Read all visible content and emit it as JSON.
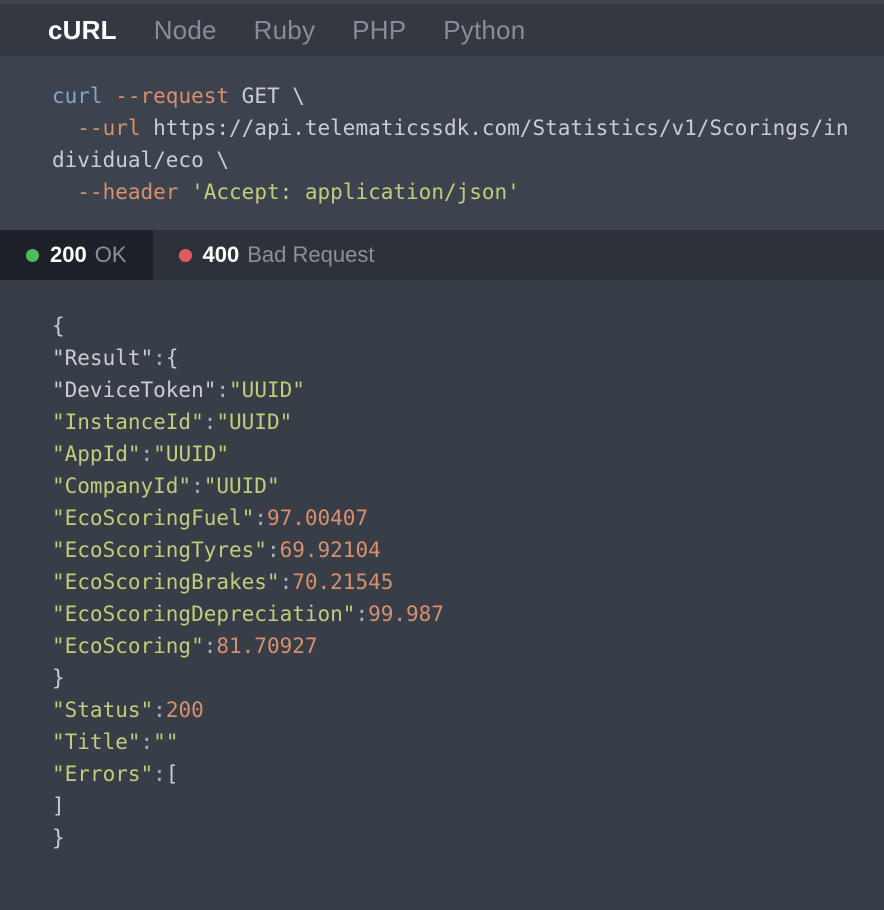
{
  "language_tabs": {
    "items": [
      {
        "label": "cURL",
        "active": true
      },
      {
        "label": "Node",
        "active": false
      },
      {
        "label": "Ruby",
        "active": false
      },
      {
        "label": "PHP",
        "active": false
      },
      {
        "label": "Python",
        "active": false
      }
    ]
  },
  "request": {
    "language": "cURL",
    "lines": [
      [
        {
          "text": "curl",
          "type": "fn"
        },
        {
          "text": " ",
          "type": "plain"
        },
        {
          "text": "--request",
          "type": "flag"
        },
        {
          "text": " GET \\",
          "type": "plain"
        }
      ],
      [
        {
          "text": "  ",
          "type": "plain"
        },
        {
          "text": "--url",
          "type": "flag"
        },
        {
          "text": " https://api.telematicssdk.com/Statistics/v1/Scorings/individual/eco \\",
          "type": "plain"
        }
      ],
      [
        {
          "text": "  ",
          "type": "plain"
        },
        {
          "text": "--header",
          "type": "flag"
        },
        {
          "text": " ",
          "type": "plain"
        },
        {
          "text": "'Accept: application/json'",
          "type": "string"
        }
      ]
    ],
    "raw": "curl --request GET \\\n  --url https://api.telematicssdk.com/Statistics/v1/Scorings/individual/eco \\\n  --header 'Accept: application/json'"
  },
  "response_tabs": {
    "items": [
      {
        "code": "200",
        "text": "OK",
        "dot_color": "#4cbb5f",
        "active": true
      },
      {
        "code": "400",
        "text": "Bad Request",
        "dot_color": "#e05c5c",
        "active": false
      }
    ]
  },
  "response_body": {
    "lines": [
      [
        {
          "text": "{",
          "type": "punc"
        }
      ],
      [
        {
          "text": "\"Result\"",
          "type": "keygray"
        },
        {
          "text": ":",
          "type": "colon"
        },
        {
          "text": "{",
          "type": "punc"
        }
      ],
      [
        {
          "text": "\"DeviceToken\"",
          "type": "keygray"
        },
        {
          "text": ":",
          "type": "colon"
        },
        {
          "text": "\"UUID\"",
          "type": "string"
        }
      ],
      [
        {
          "text": "\"InstanceId\"",
          "type": "key"
        },
        {
          "text": ":",
          "type": "colon"
        },
        {
          "text": "\"UUID\"",
          "type": "string"
        }
      ],
      [
        {
          "text": "\"AppId\"",
          "type": "key"
        },
        {
          "text": ":",
          "type": "colon"
        },
        {
          "text": "\"UUID\"",
          "type": "string"
        }
      ],
      [
        {
          "text": "\"CompanyId\"",
          "type": "key"
        },
        {
          "text": ":",
          "type": "colon"
        },
        {
          "text": "\"UUID\"",
          "type": "string"
        }
      ],
      [
        {
          "text": "\"EcoScoringFuel\"",
          "type": "key"
        },
        {
          "text": ":",
          "type": "colon"
        },
        {
          "text": "97.00407",
          "type": "num"
        }
      ],
      [
        {
          "text": "\"EcoScoringTyres\"",
          "type": "key"
        },
        {
          "text": ":",
          "type": "colon"
        },
        {
          "text": "69.92104",
          "type": "num"
        }
      ],
      [
        {
          "text": "\"EcoScoringBrakes\"",
          "type": "key"
        },
        {
          "text": ":",
          "type": "colon"
        },
        {
          "text": "70.21545",
          "type": "num"
        }
      ],
      [
        {
          "text": "\"EcoScoringDepreciation\"",
          "type": "key"
        },
        {
          "text": ":",
          "type": "colon"
        },
        {
          "text": "99.987",
          "type": "num"
        }
      ],
      [
        {
          "text": "\"EcoScoring\"",
          "type": "key"
        },
        {
          "text": ":",
          "type": "colon"
        },
        {
          "text": "81.70927",
          "type": "num"
        }
      ],
      [
        {
          "text": "}",
          "type": "punc"
        }
      ],
      [
        {
          "text": "\"Status\"",
          "type": "key"
        },
        {
          "text": ":",
          "type": "colon"
        },
        {
          "text": "200",
          "type": "num"
        }
      ],
      [
        {
          "text": "\"Title\"",
          "type": "key"
        },
        {
          "text": ":",
          "type": "colon"
        },
        {
          "text": "\"\"",
          "type": "string"
        }
      ],
      [
        {
          "text": "\"Errors\"",
          "type": "key"
        },
        {
          "text": ":",
          "type": "colon"
        },
        {
          "text": "[",
          "type": "punc"
        }
      ],
      [
        {
          "text": "]",
          "type": "punc"
        }
      ],
      [
        {
          "text": "}",
          "type": "punc"
        }
      ]
    ],
    "values": {
      "DeviceToken": "UUID",
      "InstanceId": "UUID",
      "AppId": "UUID",
      "CompanyId": "UUID",
      "EcoScoringFuel": "97.00407",
      "EcoScoringTyres": "69.92104",
      "EcoScoringBrakes": "70.21545",
      "EcoScoringDepreciation": "99.987",
      "EcoScoring": "81.70927",
      "Status": "200",
      "Title": "",
      "Errors": "[]"
    }
  },
  "theme": {
    "page_bg": "#383e48",
    "tabbar_bg": "#333841",
    "code_bg": "#3d434e",
    "status_bar_bg": "#2c313a",
    "status_tab_active_bg": "#1e2228",
    "color_function": "#7fa7cc",
    "color_flag": "#d98f6c",
    "color_plain": "#c9cdd3",
    "color_string": "#c3cc7a",
    "color_number": "#d98f6c",
    "color_tab_inactive": "#868d99",
    "color_tab_active": "#ffffff"
  }
}
